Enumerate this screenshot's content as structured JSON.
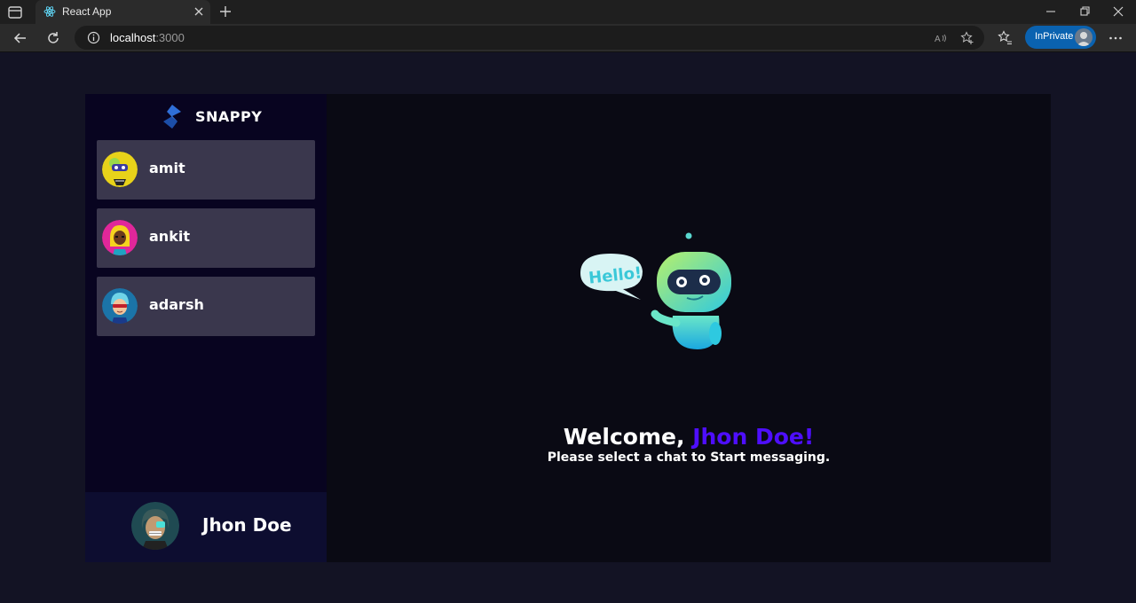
{
  "browser": {
    "tab_title": "React App",
    "url_host": "localhost",
    "url_port": ":3000",
    "inprivate_label": "InPrivate"
  },
  "app": {
    "brand_name": "SNAPPY",
    "contacts": [
      {
        "name": "amit"
      },
      {
        "name": "ankit"
      },
      {
        "name": "adarsh"
      }
    ],
    "current_user": {
      "name": "Jhon Doe"
    },
    "welcome": {
      "greeting": "Welcome,",
      "username": "Jhon Doe!",
      "subtitle": "Please select a chat to Start messaging.",
      "bubble_text": "Hello!"
    }
  },
  "colors": {
    "accent": "#4e0eff",
    "background": "#131324",
    "sidebar": "#080420",
    "contact_card": "#ffffff34"
  }
}
